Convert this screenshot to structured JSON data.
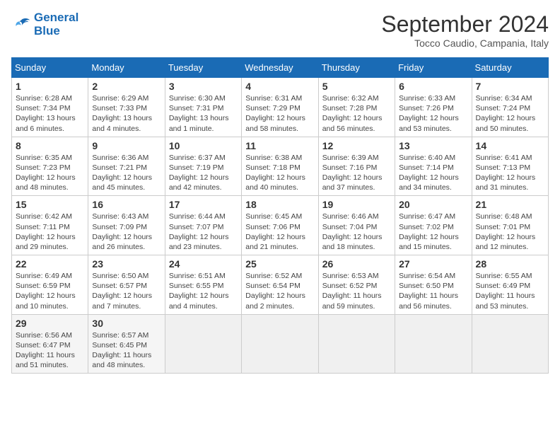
{
  "logo": {
    "line1": "General",
    "line2": "Blue"
  },
  "title": "September 2024",
  "location": "Tocco Caudio, Campania, Italy",
  "weekdays": [
    "Sunday",
    "Monday",
    "Tuesday",
    "Wednesday",
    "Thursday",
    "Friday",
    "Saturday"
  ],
  "weeks": [
    [
      {
        "day": "1",
        "info": "Sunrise: 6:28 AM\nSunset: 7:34 PM\nDaylight: 13 hours\nand 6 minutes."
      },
      {
        "day": "2",
        "info": "Sunrise: 6:29 AM\nSunset: 7:33 PM\nDaylight: 13 hours\nand 4 minutes."
      },
      {
        "day": "3",
        "info": "Sunrise: 6:30 AM\nSunset: 7:31 PM\nDaylight: 13 hours\nand 1 minute."
      },
      {
        "day": "4",
        "info": "Sunrise: 6:31 AM\nSunset: 7:29 PM\nDaylight: 12 hours\nand 58 minutes."
      },
      {
        "day": "5",
        "info": "Sunrise: 6:32 AM\nSunset: 7:28 PM\nDaylight: 12 hours\nand 56 minutes."
      },
      {
        "day": "6",
        "info": "Sunrise: 6:33 AM\nSunset: 7:26 PM\nDaylight: 12 hours\nand 53 minutes."
      },
      {
        "day": "7",
        "info": "Sunrise: 6:34 AM\nSunset: 7:24 PM\nDaylight: 12 hours\nand 50 minutes."
      }
    ],
    [
      {
        "day": "8",
        "info": "Sunrise: 6:35 AM\nSunset: 7:23 PM\nDaylight: 12 hours\nand 48 minutes."
      },
      {
        "day": "9",
        "info": "Sunrise: 6:36 AM\nSunset: 7:21 PM\nDaylight: 12 hours\nand 45 minutes."
      },
      {
        "day": "10",
        "info": "Sunrise: 6:37 AM\nSunset: 7:19 PM\nDaylight: 12 hours\nand 42 minutes."
      },
      {
        "day": "11",
        "info": "Sunrise: 6:38 AM\nSunset: 7:18 PM\nDaylight: 12 hours\nand 40 minutes."
      },
      {
        "day": "12",
        "info": "Sunrise: 6:39 AM\nSunset: 7:16 PM\nDaylight: 12 hours\nand 37 minutes."
      },
      {
        "day": "13",
        "info": "Sunrise: 6:40 AM\nSunset: 7:14 PM\nDaylight: 12 hours\nand 34 minutes."
      },
      {
        "day": "14",
        "info": "Sunrise: 6:41 AM\nSunset: 7:13 PM\nDaylight: 12 hours\nand 31 minutes."
      }
    ],
    [
      {
        "day": "15",
        "info": "Sunrise: 6:42 AM\nSunset: 7:11 PM\nDaylight: 12 hours\nand 29 minutes."
      },
      {
        "day": "16",
        "info": "Sunrise: 6:43 AM\nSunset: 7:09 PM\nDaylight: 12 hours\nand 26 minutes."
      },
      {
        "day": "17",
        "info": "Sunrise: 6:44 AM\nSunset: 7:07 PM\nDaylight: 12 hours\nand 23 minutes."
      },
      {
        "day": "18",
        "info": "Sunrise: 6:45 AM\nSunset: 7:06 PM\nDaylight: 12 hours\nand 21 minutes."
      },
      {
        "day": "19",
        "info": "Sunrise: 6:46 AM\nSunset: 7:04 PM\nDaylight: 12 hours\nand 18 minutes."
      },
      {
        "day": "20",
        "info": "Sunrise: 6:47 AM\nSunset: 7:02 PM\nDaylight: 12 hours\nand 15 minutes."
      },
      {
        "day": "21",
        "info": "Sunrise: 6:48 AM\nSunset: 7:01 PM\nDaylight: 12 hours\nand 12 minutes."
      }
    ],
    [
      {
        "day": "22",
        "info": "Sunrise: 6:49 AM\nSunset: 6:59 PM\nDaylight: 12 hours\nand 10 minutes."
      },
      {
        "day": "23",
        "info": "Sunrise: 6:50 AM\nSunset: 6:57 PM\nDaylight: 12 hours\nand 7 minutes."
      },
      {
        "day": "24",
        "info": "Sunrise: 6:51 AM\nSunset: 6:55 PM\nDaylight: 12 hours\nand 4 minutes."
      },
      {
        "day": "25",
        "info": "Sunrise: 6:52 AM\nSunset: 6:54 PM\nDaylight: 12 hours\nand 2 minutes."
      },
      {
        "day": "26",
        "info": "Sunrise: 6:53 AM\nSunset: 6:52 PM\nDaylight: 11 hours\nand 59 minutes."
      },
      {
        "day": "27",
        "info": "Sunrise: 6:54 AM\nSunset: 6:50 PM\nDaylight: 11 hours\nand 56 minutes."
      },
      {
        "day": "28",
        "info": "Sunrise: 6:55 AM\nSunset: 6:49 PM\nDaylight: 11 hours\nand 53 minutes."
      }
    ],
    [
      {
        "day": "29",
        "info": "Sunrise: 6:56 AM\nSunset: 6:47 PM\nDaylight: 11 hours\nand 51 minutes."
      },
      {
        "day": "30",
        "info": "Sunrise: 6:57 AM\nSunset: 6:45 PM\nDaylight: 11 hours\nand 48 minutes."
      },
      {
        "day": "",
        "info": ""
      },
      {
        "day": "",
        "info": ""
      },
      {
        "day": "",
        "info": ""
      },
      {
        "day": "",
        "info": ""
      },
      {
        "day": "",
        "info": ""
      }
    ]
  ]
}
